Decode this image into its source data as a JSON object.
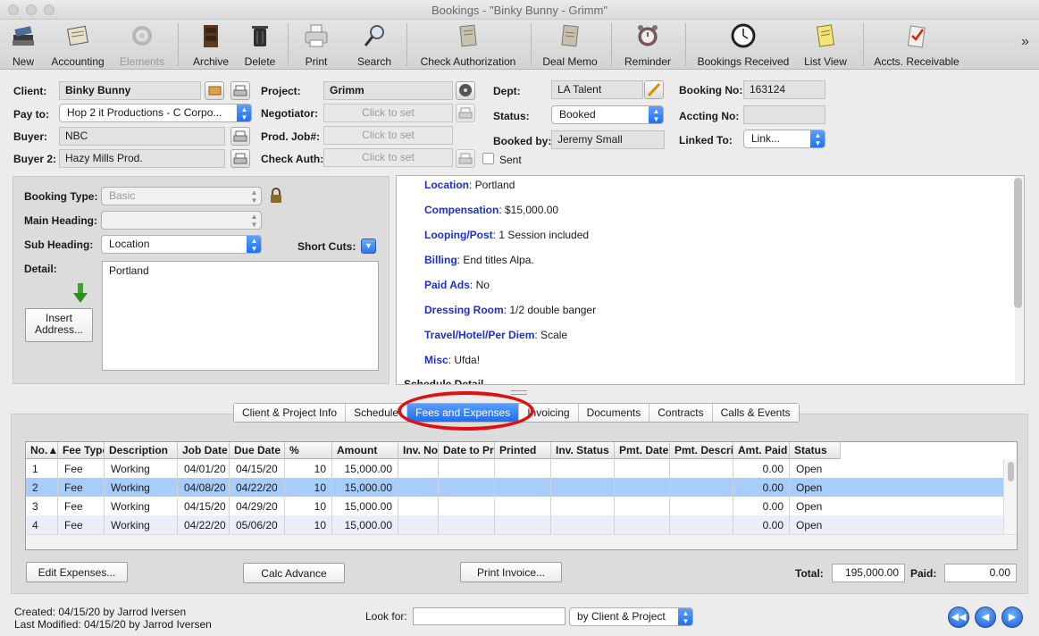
{
  "window": {
    "title": "Bookings - \"Binky Bunny - Grimm\""
  },
  "toolbar": {
    "items": [
      {
        "label": "New",
        "icon": "books-icon"
      },
      {
        "label": "Accounting",
        "icon": "ledger-icon"
      },
      {
        "label": "Elements",
        "icon": "elements-icon",
        "disabled": true
      },
      {
        "label": "Archive",
        "icon": "cabinet-icon"
      },
      {
        "label": "Delete",
        "icon": "trash-icon"
      },
      {
        "label": "Print",
        "icon": "printer-icon"
      },
      {
        "label": "Search",
        "icon": "magnifier-icon"
      },
      {
        "label": "Check Authorization",
        "icon": "document-icon"
      },
      {
        "label": "Deal Memo",
        "icon": "memo-icon"
      },
      {
        "label": "Reminder",
        "icon": "alarm-clock-icon"
      },
      {
        "label": "Bookings Received",
        "icon": "clock-icon"
      },
      {
        "label": "List View",
        "icon": "notepad-icon"
      },
      {
        "label": "Accts. Receivable",
        "icon": "checklist-icon"
      }
    ],
    "overflow": "»"
  },
  "form": {
    "client_label": "Client:",
    "client_value": "Binky Bunny",
    "payto_label": "Pay to:",
    "payto_value": "Hop 2 it Productions - C Corpo...",
    "buyer_label": "Buyer:",
    "buyer_value": "NBC",
    "buyer2_label": "Buyer 2:",
    "buyer2_value": "Hazy Mills Prod.",
    "project_label": "Project:",
    "project_value": "Grimm",
    "negotiator_label": "Negotiator:",
    "negotiator_value": "Click to set",
    "prodjob_label": "Prod. Job#:",
    "prodjob_value": "Click to set",
    "checkauth_label": "Check Auth:",
    "checkauth_value": "Click to set",
    "dept_label": "Dept:",
    "dept_value": "LA Talent",
    "status_label": "Status:",
    "status_value": "Booked",
    "bookedby_label": "Booked by:",
    "bookedby_value": "Jeremy Small",
    "sent_label": "Sent",
    "bookingno_label": "Booking No:",
    "bookingno_value": "163124",
    "acctingno_label": "Accting No:",
    "acctingno_value": "",
    "linkedto_label": "Linked To:",
    "linkedto_value": "Link..."
  },
  "details": {
    "booking_type_label": "Booking Type:",
    "booking_type_value": "Basic",
    "main_heading_label": "Main Heading:",
    "main_heading_value": "",
    "sub_heading_label": "Sub Heading:",
    "sub_heading_value": "Location",
    "short_cuts_label": "Short Cuts:",
    "detail_label": "Detail:",
    "detail_value": "Portland",
    "insert_address_label": "Insert Address..."
  },
  "notes": [
    {
      "key": "Location",
      "value": ": Portland"
    },
    {
      "key": "Compensation",
      "value": ": $15,000.00"
    },
    {
      "key": "Looping/Post",
      "value": ": 1 Session included"
    },
    {
      "key": "Billing",
      "value": ": End titles Alpa."
    },
    {
      "key": "Paid Ads",
      "value": ": No"
    },
    {
      "key": "Dressing Room",
      "value": ": 1/2 double banger"
    },
    {
      "key": "Travel/Hotel/Per Diem",
      "value": ": Scale"
    },
    {
      "key": "Misc",
      "value": ": Ufda!"
    }
  ],
  "notes_partial": "Schedule Detail",
  "tabs": [
    {
      "label": "Client & Project Info"
    },
    {
      "label": "Schedule"
    },
    {
      "label": "Fees and Expenses",
      "active": true
    },
    {
      "label": "Invoicing"
    },
    {
      "label": "Documents"
    },
    {
      "label": "Contracts"
    },
    {
      "label": "Calls & Events"
    }
  ],
  "fees_table": {
    "columns": [
      "No.▲",
      "Fee Type",
      "Description",
      "Job Date",
      "Due Date",
      "%",
      "Amount",
      "Inv. No",
      "Date to Pr",
      "Printed",
      "Inv. Status",
      "Pmt. Date",
      "Pmt. Descri",
      "Amt. Paid",
      "Status"
    ],
    "rows": [
      [
        "1",
        "Fee",
        "Working",
        "04/01/20",
        "04/15/20",
        "10",
        "15,000.00",
        "",
        "",
        "",
        "",
        "",
        "",
        "0.00",
        "Open"
      ],
      [
        "2",
        "Fee",
        "Working",
        "04/08/20",
        "04/22/20",
        "10",
        "15,000.00",
        "",
        "",
        "",
        "",
        "",
        "",
        "0.00",
        "Open"
      ],
      [
        "3",
        "Fee",
        "Working",
        "04/15/20",
        "04/29/20",
        "10",
        "15,000.00",
        "",
        "",
        "",
        "",
        "",
        "",
        "0.00",
        "Open"
      ],
      [
        "4",
        "Fee",
        "Working",
        "04/22/20",
        "05/06/20",
        "10",
        "15,000.00",
        "",
        "",
        "",
        "",
        "",
        "",
        "0.00",
        "Open"
      ]
    ],
    "selected_row": 1
  },
  "actions": {
    "edit_expenses": "Edit Expenses...",
    "calc_advance": "Calc Advance",
    "print_invoice": "Print Invoice...",
    "total_label": "Total:",
    "total_value": "195,000.00",
    "paid_label": "Paid:",
    "paid_value": "0.00"
  },
  "footer": {
    "created": "Created: 04/15/20 by Jarrod Iversen",
    "modified": "Last Modified: 04/15/20 by Jarrod Iversen",
    "look_for_label": "Look for:",
    "look_for_value": "",
    "look_by": "by Client & Project"
  },
  "colors": {
    "accent": "#1e6cf2",
    "selected_row": "#a9cdfb",
    "alt_row": "#e9eef8",
    "highlight_ring": "#e01010",
    "note_key": "#1b2fd4"
  }
}
